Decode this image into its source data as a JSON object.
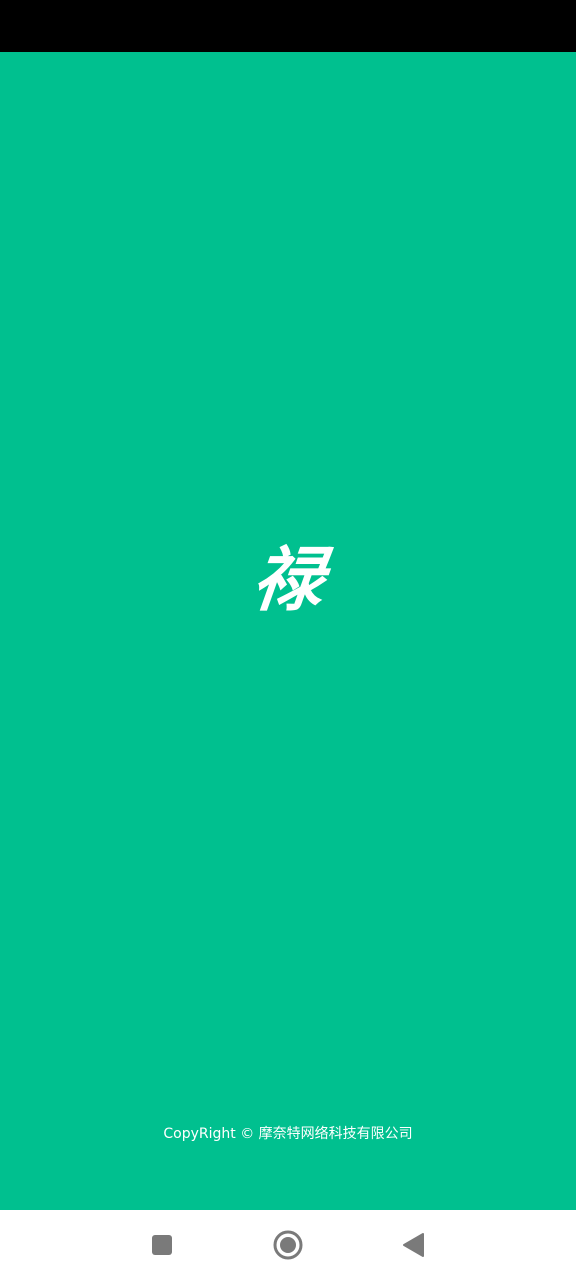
{
  "splash": {
    "background_color": "#00C08F",
    "logo_text": "禄",
    "copyright": "CopyRight © 摩奈特网络科技有限公司"
  },
  "status_bar": {
    "background_color": "#000000"
  },
  "nav_bar": {
    "background_color": "#FFFFFF",
    "icon_color": "#7A7A7A",
    "buttons": [
      {
        "icon": "square-recents-icon"
      },
      {
        "icon": "circle-home-icon"
      },
      {
        "icon": "triangle-back-icon"
      }
    ]
  }
}
